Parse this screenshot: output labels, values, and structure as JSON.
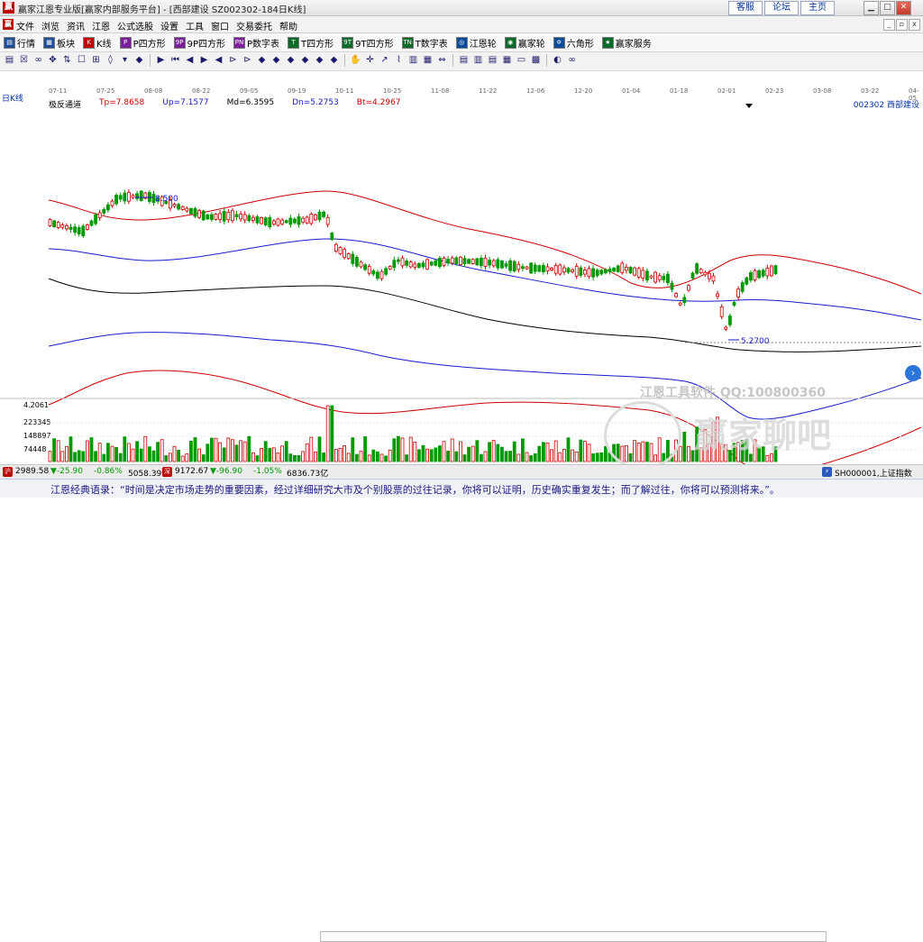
{
  "window": {
    "app_icon": "赢",
    "title": "赢家江恩专业版[赢家内部服务平台] - [西部建设  SZ002302-184日K线]",
    "links": [
      "客服",
      "论坛",
      "主页"
    ]
  },
  "menu": {
    "icon": "赢",
    "items": [
      "文件",
      "浏览",
      "资讯",
      "江恩",
      "公式选股",
      "设置",
      "工具",
      "窗口",
      "交易委托",
      "帮助"
    ]
  },
  "toolbar1": {
    "items": [
      {
        "icon": "grid-icon",
        "glyph": "▤",
        "color": "#1f4f9a",
        "label": "行情"
      },
      {
        "icon": "block-icon",
        "glyph": "▦",
        "color": "#1f4f9a",
        "label": "板块"
      },
      {
        "icon": "kline-icon",
        "glyph": "K",
        "color": "#c00000",
        "label": "K线"
      },
      {
        "icon": "p-square-icon",
        "glyph": "P",
        "color": "#7a1f9a",
        "label": "P四方形"
      },
      {
        "icon": "9p-square-icon",
        "glyph": "9P",
        "color": "#7a1f9a",
        "label": "9P四方形"
      },
      {
        "icon": "pn-table-icon",
        "glyph": "PN",
        "color": "#7a1f9a",
        "label": "P数字表"
      },
      {
        "icon": "t-square-icon",
        "glyph": "T",
        "color": "#0a6a2a",
        "label": "T四方形"
      },
      {
        "icon": "9t-square-icon",
        "glyph": "9T",
        "color": "#0a6a2a",
        "label": "9T四方形"
      },
      {
        "icon": "tn-table-icon",
        "glyph": "TN",
        "color": "#0a6a2a",
        "label": "T数字表"
      },
      {
        "icon": "gann-wheel-icon",
        "glyph": "◎",
        "color": "#0a4a9a",
        "label": "江恩轮"
      },
      {
        "icon": "winner-wheel-icon",
        "glyph": "◉",
        "color": "#0a6a2a",
        "label": "赢家轮"
      },
      {
        "icon": "hexagon-icon",
        "glyph": "✡",
        "color": "#0a4a9a",
        "label": "六角形"
      },
      {
        "icon": "service-icon",
        "glyph": "★",
        "color": "#0a6a2a",
        "label": "赢家服务"
      }
    ]
  },
  "toolbar2": {
    "icons": [
      "▤",
      "☒",
      "∞",
      "✥",
      "⇅",
      "☐",
      "⊞",
      "◊",
      "▾",
      "◆",
      "|",
      "▶",
      "⏮",
      "◀",
      "▶",
      "◀",
      "⊳",
      "⊳",
      "◆",
      "◆",
      "◆",
      "◆",
      "◆",
      "◆",
      "|",
      "✋",
      "✛",
      "↗",
      "⌇",
      "▥",
      "▦",
      "⇔",
      "|",
      "▤",
      "▥",
      "▤",
      "▦",
      "▭",
      "▩",
      "|",
      "◐",
      "∞"
    ]
  },
  "chart": {
    "period_label": "日K线",
    "date_ticks": [
      "07-11",
      "07-25",
      "08-08",
      "08-22",
      "09-05",
      "09-19",
      "10-11",
      "10-25",
      "11-08",
      "11-22",
      "12-06",
      "12-20",
      "01-04",
      "01-18",
      "02-01",
      "02-23",
      "03-08",
      "03-22",
      "04-05"
    ],
    "indicator_name": "极反通道",
    "tp": "Tp=7.8658",
    "up": "Up=7.1577",
    "md": "Md=6.3595",
    "dn": "Dn=5.2753",
    "bt": "Bt=4.2967",
    "stock": "002302  西部建设",
    "high_annotation": "8.500",
    "low_annotation": "5.2700",
    "volume_ticks": [
      "4.2061",
      "223345",
      "148897",
      "74448"
    ],
    "colors": {
      "tp": "#cc0000",
      "up": "#1a1acc",
      "md": "#000000",
      "up_candle": "#cc0000",
      "down_candle": "#009900"
    }
  },
  "watermark": {
    "line1": "江恩工具软件  QQ:100800360",
    "line2": "赢家聊吧"
  },
  "status": {
    "sh_value": "2989.58",
    "sh_change": "▼-25.90",
    "sh_pct": "-0.86%",
    "sh_amount": "5058.39亿",
    "sz_value": "9172.67",
    "sz_change": "▼-96.90",
    "sz_pct": "-1.05%",
    "sz_amount": "6836.73亿",
    "index_name": "SH000001,上证指数"
  },
  "quote": {
    "text": "江恩经典语录：“时间是决定市场走势的重要因素，经过详细研究大市及个别股票的过往记录，你将可以证明，历史确实重复发生；而了解过往，你将可以预测将来。”。"
  }
}
